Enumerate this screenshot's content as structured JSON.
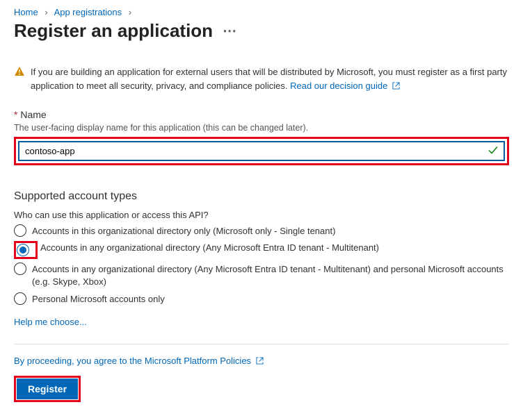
{
  "breadcrumb": {
    "home": "Home",
    "appReg": "App registrations"
  },
  "title": "Register an application",
  "warning": {
    "text": "If you are building an application for external users that will be distributed by Microsoft, you must register as a first party application to meet all security, privacy, and compliance policies. ",
    "link": "Read our decision guide"
  },
  "name": {
    "label": "Name",
    "hint": "The user-facing display name for this application (this can be changed later).",
    "value": "contoso-app"
  },
  "account": {
    "title": "Supported account types",
    "question": "Who can use this application or access this API?",
    "options": [
      "Accounts in this organizational directory only (Microsoft only - Single tenant)",
      "Accounts in any organizational directory (Any Microsoft Entra ID tenant - Multitenant)",
      "Accounts in any organizational directory (Any Microsoft Entra ID tenant - Multitenant) and personal Microsoft accounts (e.g. Skype, Xbox)",
      "Personal Microsoft accounts only"
    ],
    "selectedIndex": 1,
    "helpLink": "Help me choose..."
  },
  "agree": "By proceeding, you agree to the Microsoft Platform Policies",
  "registerLabel": "Register"
}
